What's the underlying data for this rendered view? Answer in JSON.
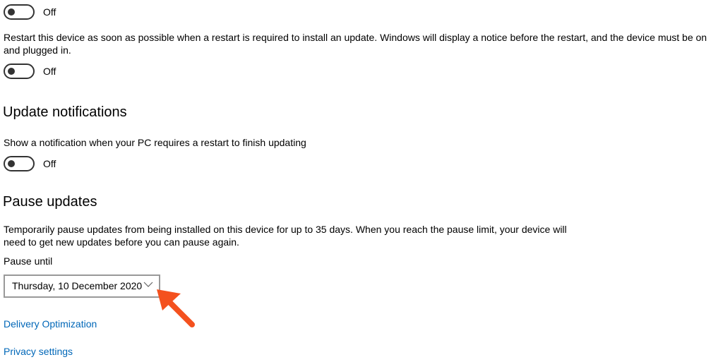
{
  "toggles": [
    {
      "state": "Off"
    },
    {
      "state": "Off"
    },
    {
      "state": "Off"
    }
  ],
  "restart": {
    "description": "Restart this device as soon as possible when a restart is required to install an update. Windows will display a notice before the restart, and the device must be on and plugged in."
  },
  "update_notifications": {
    "title": "Update notifications",
    "description": "Show a notification when your PC requires a restart to finish updating"
  },
  "pause_updates": {
    "title": "Pause updates",
    "description": "Temporarily pause updates from being installed on this device for up to 35 days. When you reach the pause limit, your device will need to get new updates before you can pause again.",
    "pause_until_label": "Pause until",
    "selected_date": "Thursday, 10 December 2020"
  },
  "links": {
    "delivery_optimization": "Delivery Optimization",
    "privacy_settings": "Privacy settings"
  },
  "colors": {
    "link": "#0067b8",
    "annotation_arrow": "#f4511e"
  },
  "icons": {
    "dropdown": "chevron-down-icon",
    "annotation": "arrow-annotation-icon"
  }
}
